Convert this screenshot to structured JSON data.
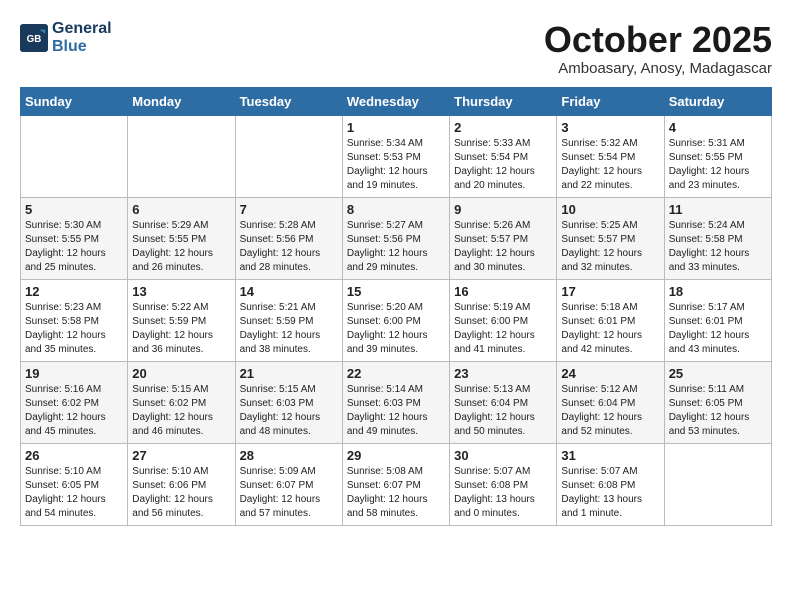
{
  "header": {
    "logo_line1": "General",
    "logo_line2": "Blue",
    "month": "October 2025",
    "location": "Amboasary, Anosy, Madagascar"
  },
  "weekdays": [
    "Sunday",
    "Monday",
    "Tuesday",
    "Wednesday",
    "Thursday",
    "Friday",
    "Saturday"
  ],
  "weeks": [
    [
      {
        "day": "",
        "content": ""
      },
      {
        "day": "",
        "content": ""
      },
      {
        "day": "",
        "content": ""
      },
      {
        "day": "1",
        "content": "Sunrise: 5:34 AM\nSunset: 5:53 PM\nDaylight: 12 hours\nand 19 minutes."
      },
      {
        "day": "2",
        "content": "Sunrise: 5:33 AM\nSunset: 5:54 PM\nDaylight: 12 hours\nand 20 minutes."
      },
      {
        "day": "3",
        "content": "Sunrise: 5:32 AM\nSunset: 5:54 PM\nDaylight: 12 hours\nand 22 minutes."
      },
      {
        "day": "4",
        "content": "Sunrise: 5:31 AM\nSunset: 5:55 PM\nDaylight: 12 hours\nand 23 minutes."
      }
    ],
    [
      {
        "day": "5",
        "content": "Sunrise: 5:30 AM\nSunset: 5:55 PM\nDaylight: 12 hours\nand 25 minutes."
      },
      {
        "day": "6",
        "content": "Sunrise: 5:29 AM\nSunset: 5:55 PM\nDaylight: 12 hours\nand 26 minutes."
      },
      {
        "day": "7",
        "content": "Sunrise: 5:28 AM\nSunset: 5:56 PM\nDaylight: 12 hours\nand 28 minutes."
      },
      {
        "day": "8",
        "content": "Sunrise: 5:27 AM\nSunset: 5:56 PM\nDaylight: 12 hours\nand 29 minutes."
      },
      {
        "day": "9",
        "content": "Sunrise: 5:26 AM\nSunset: 5:57 PM\nDaylight: 12 hours\nand 30 minutes."
      },
      {
        "day": "10",
        "content": "Sunrise: 5:25 AM\nSunset: 5:57 PM\nDaylight: 12 hours\nand 32 minutes."
      },
      {
        "day": "11",
        "content": "Sunrise: 5:24 AM\nSunset: 5:58 PM\nDaylight: 12 hours\nand 33 minutes."
      }
    ],
    [
      {
        "day": "12",
        "content": "Sunrise: 5:23 AM\nSunset: 5:58 PM\nDaylight: 12 hours\nand 35 minutes."
      },
      {
        "day": "13",
        "content": "Sunrise: 5:22 AM\nSunset: 5:59 PM\nDaylight: 12 hours\nand 36 minutes."
      },
      {
        "day": "14",
        "content": "Sunrise: 5:21 AM\nSunset: 5:59 PM\nDaylight: 12 hours\nand 38 minutes."
      },
      {
        "day": "15",
        "content": "Sunrise: 5:20 AM\nSunset: 6:00 PM\nDaylight: 12 hours\nand 39 minutes."
      },
      {
        "day": "16",
        "content": "Sunrise: 5:19 AM\nSunset: 6:00 PM\nDaylight: 12 hours\nand 41 minutes."
      },
      {
        "day": "17",
        "content": "Sunrise: 5:18 AM\nSunset: 6:01 PM\nDaylight: 12 hours\nand 42 minutes."
      },
      {
        "day": "18",
        "content": "Sunrise: 5:17 AM\nSunset: 6:01 PM\nDaylight: 12 hours\nand 43 minutes."
      }
    ],
    [
      {
        "day": "19",
        "content": "Sunrise: 5:16 AM\nSunset: 6:02 PM\nDaylight: 12 hours\nand 45 minutes."
      },
      {
        "day": "20",
        "content": "Sunrise: 5:15 AM\nSunset: 6:02 PM\nDaylight: 12 hours\nand 46 minutes."
      },
      {
        "day": "21",
        "content": "Sunrise: 5:15 AM\nSunset: 6:03 PM\nDaylight: 12 hours\nand 48 minutes."
      },
      {
        "day": "22",
        "content": "Sunrise: 5:14 AM\nSunset: 6:03 PM\nDaylight: 12 hours\nand 49 minutes."
      },
      {
        "day": "23",
        "content": "Sunrise: 5:13 AM\nSunset: 6:04 PM\nDaylight: 12 hours\nand 50 minutes."
      },
      {
        "day": "24",
        "content": "Sunrise: 5:12 AM\nSunset: 6:04 PM\nDaylight: 12 hours\nand 52 minutes."
      },
      {
        "day": "25",
        "content": "Sunrise: 5:11 AM\nSunset: 6:05 PM\nDaylight: 12 hours\nand 53 minutes."
      }
    ],
    [
      {
        "day": "26",
        "content": "Sunrise: 5:10 AM\nSunset: 6:05 PM\nDaylight: 12 hours\nand 54 minutes."
      },
      {
        "day": "27",
        "content": "Sunrise: 5:10 AM\nSunset: 6:06 PM\nDaylight: 12 hours\nand 56 minutes."
      },
      {
        "day": "28",
        "content": "Sunrise: 5:09 AM\nSunset: 6:07 PM\nDaylight: 12 hours\nand 57 minutes."
      },
      {
        "day": "29",
        "content": "Sunrise: 5:08 AM\nSunset: 6:07 PM\nDaylight: 12 hours\nand 58 minutes."
      },
      {
        "day": "30",
        "content": "Sunrise: 5:07 AM\nSunset: 6:08 PM\nDaylight: 13 hours\nand 0 minutes."
      },
      {
        "day": "31",
        "content": "Sunrise: 5:07 AM\nSunset: 6:08 PM\nDaylight: 13 hours\nand 1 minute."
      },
      {
        "day": "",
        "content": ""
      }
    ]
  ]
}
